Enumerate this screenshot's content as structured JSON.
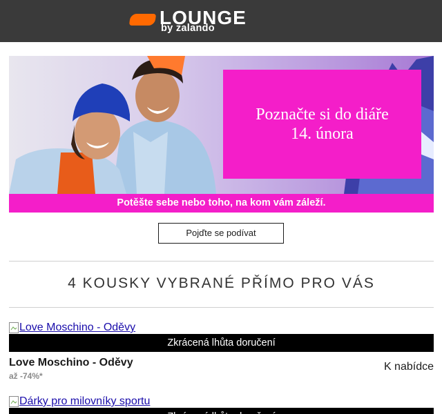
{
  "header": {
    "logo_word": "LOUNGE",
    "logo_sub": "by zalando",
    "bg_color": "#3a3a3a",
    "accent_color": "#ff6900"
  },
  "banner": {
    "promo_title": "Poznačte si do diáře 14. února",
    "subline": "Potěšte sebe nebo toho, na kom vám záleží.",
    "pink_color": "#f41ec9"
  },
  "cta": {
    "label": "Pojďte se podívat"
  },
  "section": {
    "title": "4 KOUSKY VYBRANÉ PŘÍMO PRO VÁS"
  },
  "products": [
    {
      "image_alt": "Love Moschino - Oděvy",
      "delivery_label": "Zkrácená lhůta doručení",
      "name": "Love Moschino - Oděvy",
      "discount": "až -74%*",
      "link_label": "K nabídce"
    },
    {
      "image_alt": "Dárky pro milovníky sportu",
      "delivery_label": "Zkrácená lhůta doručení"
    }
  ]
}
